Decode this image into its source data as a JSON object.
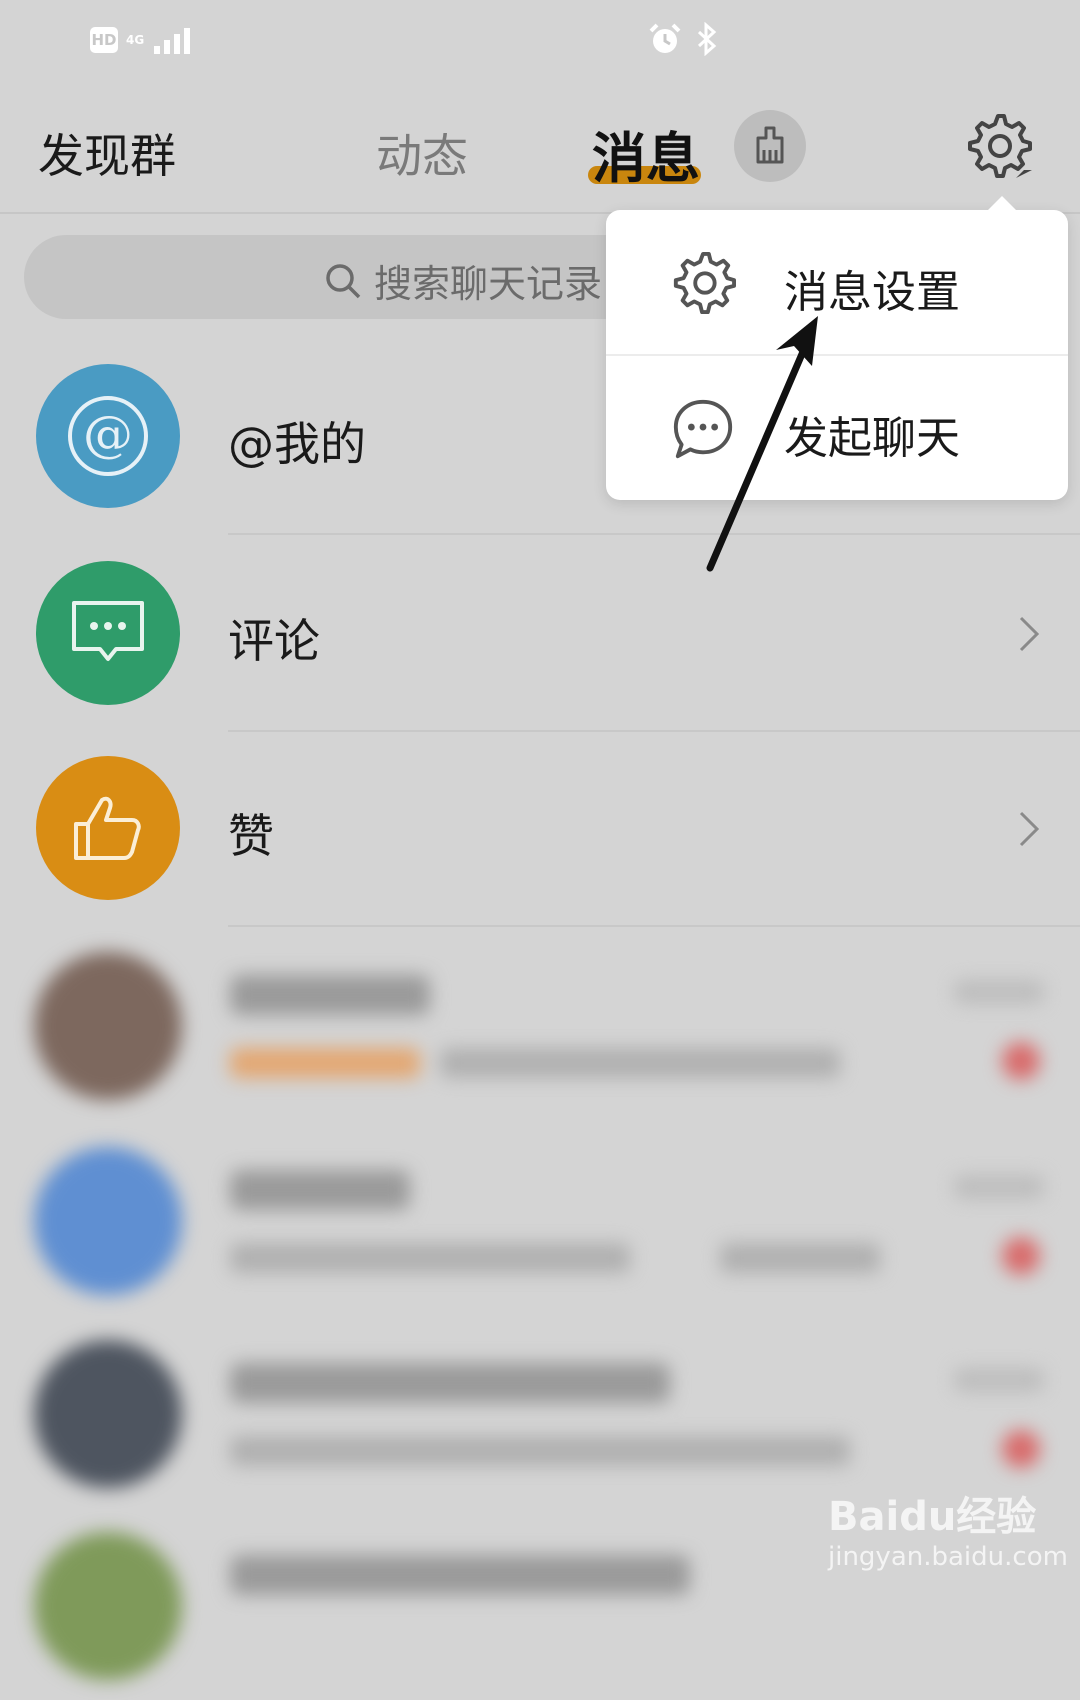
{
  "status_bar": {
    "hd": "HD",
    "network": "4G"
  },
  "header": {
    "discover_label": "发现群",
    "tab_dongtai": "动态",
    "tab_xiaoxi": "消息"
  },
  "search": {
    "placeholder": "搜索聊天记录"
  },
  "list": [
    {
      "label": "@我的",
      "color": "#4a9bc3"
    },
    {
      "label": "评论",
      "color": "#2f9c6a"
    },
    {
      "label": "赞",
      "color": "#d98d14"
    }
  ],
  "popup_menu": {
    "items": [
      {
        "label": "消息设置",
        "icon": "gear-icon"
      },
      {
        "label": "发起聊天",
        "icon": "chat-bubble-icon"
      }
    ]
  },
  "watermark": {
    "logo": "Baidu经验",
    "url": "jingyan.baidu.com"
  },
  "colors": {
    "accent": "#c9860e",
    "background": "#d4d4d4"
  }
}
